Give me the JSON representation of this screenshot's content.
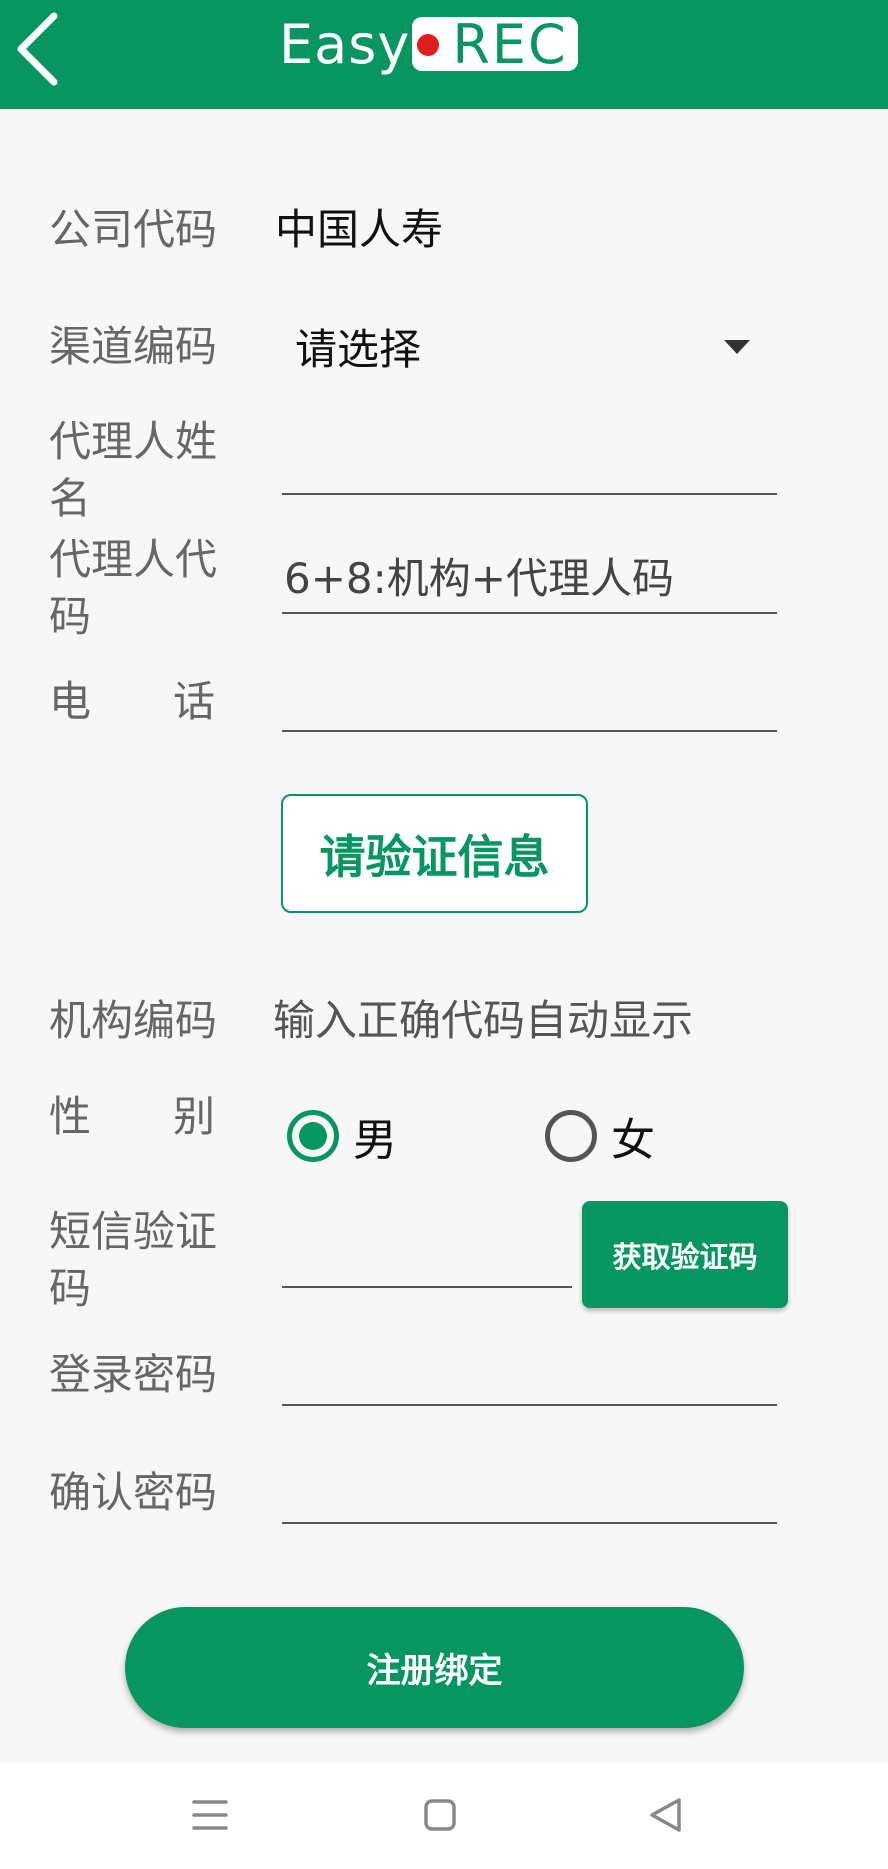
{
  "header": {
    "logo": {
      "part1": "Easy",
      "part2": "REC"
    },
    "icons": {
      "back": "back-chevron-icon"
    }
  },
  "form": {
    "company_code": {
      "label": "公司代码",
      "value": "中国人寿"
    },
    "channel_code": {
      "label": "渠道编码",
      "value": "请选择",
      "icon": "caret-down-icon"
    },
    "agent_name": {
      "label": "代理人姓名",
      "value": ""
    },
    "agent_code": {
      "label": "代理人代码",
      "placeholder": "6+8:机构+代理人码",
      "value": ""
    },
    "phone": {
      "label_chars": [
        "电",
        "话"
      ],
      "value": ""
    },
    "verify_button": "请验证信息",
    "org_code": {
      "label": "机构编码",
      "value": "输入正确代码自动显示"
    },
    "gender": {
      "label_chars": [
        "性",
        "别"
      ],
      "options": [
        {
          "label": "男",
          "checked": true
        },
        {
          "label": "女",
          "checked": false
        }
      ]
    },
    "sms_code": {
      "label": "短信验证码",
      "value": "",
      "button": "获取验证码"
    },
    "password": {
      "label": "登录密码",
      "value": ""
    },
    "confirm_password": {
      "label": "确认密码",
      "value": ""
    },
    "submit_button": "注册绑定"
  },
  "navbar": {
    "icons": [
      "menu-icon",
      "home-square-icon",
      "back-triangle-icon"
    ]
  },
  "colors": {
    "brand_green": "#079562",
    "logo_dot_red": "#e01e1e",
    "background": "#f7f7f7",
    "label_gray": "#666666"
  }
}
